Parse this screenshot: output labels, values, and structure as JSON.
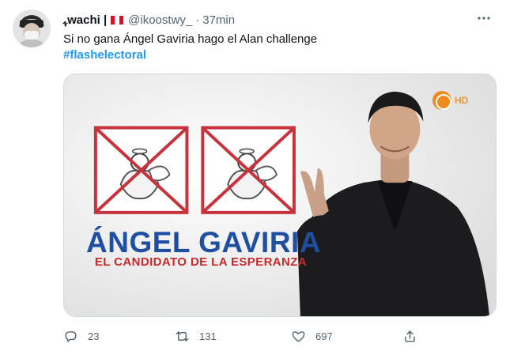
{
  "user": {
    "display_name": "ﮩwachi |",
    "handle": "@ikoostwy_",
    "separator": "·",
    "time": "37min"
  },
  "tweet": {
    "text": "Si no gana Ángel Gaviria hago el Alan challenge",
    "hashtag": "#flashelectoral"
  },
  "media": {
    "headline": "ÁNGEL GAVIRIA",
    "subline": "EL CANDIDATO DE LA ESPERANZA",
    "logo_label": "HD"
  },
  "actions": {
    "replies": "23",
    "retweets": "131",
    "likes": "697"
  },
  "colors": {
    "accent": "#1d9bf0",
    "secondary_text": "#536471",
    "headline_blue": "#1e4fa3",
    "subline_red": "#c62a2a",
    "flag_red": "#d91023"
  },
  "icons": [
    "more-icon",
    "reply-icon",
    "retweet-icon",
    "like-icon",
    "share-icon",
    "peru-flag-icon",
    "channel-logo-icon"
  ]
}
